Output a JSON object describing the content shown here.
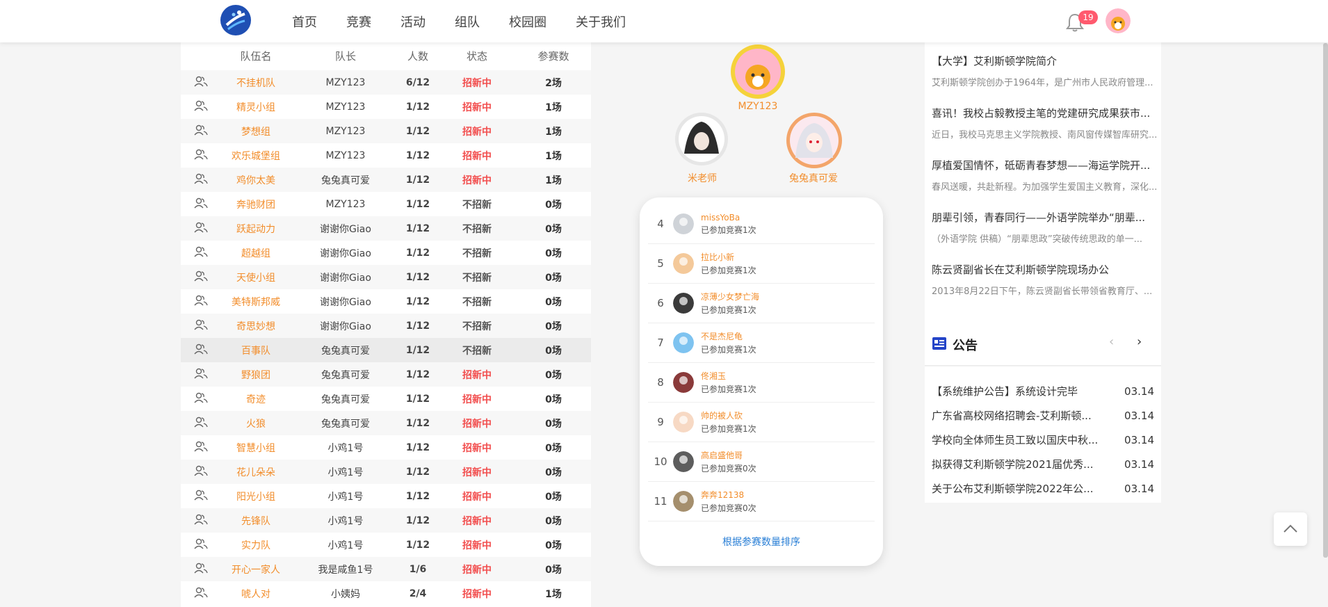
{
  "header": {
    "nav": [
      "首页",
      "竞赛",
      "活动",
      "组队",
      "校园圈",
      "关于我们"
    ],
    "notification_count": "19"
  },
  "team_table": {
    "columns": [
      "队伍名",
      "队长",
      "人数",
      "状态",
      "参赛数"
    ],
    "rows": [
      {
        "name": "不挂机队",
        "leader": "MZY123",
        "count": "6/12",
        "status": "招新中",
        "games": "2场"
      },
      {
        "name": "精灵小组",
        "leader": "MZY123",
        "count": "1/12",
        "status": "招新中",
        "games": "1场"
      },
      {
        "name": "梦想组",
        "leader": "MZY123",
        "count": "1/12",
        "status": "招新中",
        "games": "1场"
      },
      {
        "name": "欢乐城堡组",
        "leader": "MZY123",
        "count": "1/12",
        "status": "招新中",
        "games": "1场"
      },
      {
        "name": "鸡你太美",
        "leader": "兔兔真可爱",
        "count": "1/12",
        "status": "招新中",
        "games": "1场"
      },
      {
        "name": "奔驰财团",
        "leader": "MZY123",
        "count": "1/12",
        "status": "不招新",
        "games": "0场"
      },
      {
        "name": "跃起动力",
        "leader": "谢谢你Giao",
        "count": "1/12",
        "status": "不招新",
        "games": "0场"
      },
      {
        "name": "超越组",
        "leader": "谢谢你Giao",
        "count": "1/12",
        "status": "不招新",
        "games": "0场"
      },
      {
        "name": "天使小组",
        "leader": "谢谢你Giao",
        "count": "1/12",
        "status": "不招新",
        "games": "0场"
      },
      {
        "name": "美特斯邦威",
        "leader": "谢谢你Giao",
        "count": "1/12",
        "status": "不招新",
        "games": "0场"
      },
      {
        "name": "奇思妙想",
        "leader": "谢谢你Giao",
        "count": "1/12",
        "status": "不招新",
        "games": "0场"
      },
      {
        "name": "百事队",
        "leader": "兔兔真可爱",
        "count": "1/12",
        "status": "不招新",
        "games": "0场"
      },
      {
        "name": "野狼团",
        "leader": "兔兔真可爱",
        "count": "1/12",
        "status": "招新中",
        "games": "0场"
      },
      {
        "name": "奇迹",
        "leader": "兔兔真可爱",
        "count": "1/12",
        "status": "招新中",
        "games": "0场"
      },
      {
        "name": "火狼",
        "leader": "兔兔真可爱",
        "count": "1/12",
        "status": "招新中",
        "games": "0场"
      },
      {
        "name": "智慧小组",
        "leader": "小鸡1号",
        "count": "1/12",
        "status": "招新中",
        "games": "0场"
      },
      {
        "name": "花儿朵朵",
        "leader": "小鸡1号",
        "count": "1/12",
        "status": "招新中",
        "games": "0场"
      },
      {
        "name": "阳光小组",
        "leader": "小鸡1号",
        "count": "1/12",
        "status": "招新中",
        "games": "0场"
      },
      {
        "name": "先锋队",
        "leader": "小鸡1号",
        "count": "1/12",
        "status": "招新中",
        "games": "0场"
      },
      {
        "name": "实力队",
        "leader": "小鸡1号",
        "count": "1/12",
        "status": "招新中",
        "games": "0场"
      },
      {
        "name": "开心一家人",
        "leader": "我是咸鱼1号",
        "count": "1/6",
        "status": "招新中",
        "games": "0场"
      },
      {
        "name": "唬人对",
        "leader": "小姨妈",
        "count": "2/4",
        "status": "招新中",
        "games": "1场"
      }
    ]
  },
  "podium": {
    "first": "MZY123",
    "second": "米老师",
    "third": "兔兔真可爱"
  },
  "ranking": {
    "items": [
      {
        "rank": "4",
        "name": "missYoBa",
        "sub": "已参加竞赛1次"
      },
      {
        "rank": "5",
        "name": "拉比小新",
        "sub": "已参加竞赛1次"
      },
      {
        "rank": "6",
        "name": "凉薄少女梦亡海",
        "sub": "已参加竞赛1次"
      },
      {
        "rank": "7",
        "name": "不是杰尼龟",
        "sub": "已参加竞赛1次"
      },
      {
        "rank": "8",
        "name": "佟湘玉",
        "sub": "已参加竞赛1次"
      },
      {
        "rank": "9",
        "name": "帅的被人砍",
        "sub": "已参加竞赛1次"
      },
      {
        "rank": "10",
        "name": "高启盛他哥",
        "sub": "已参加竞赛0次"
      },
      {
        "rank": "11",
        "name": "奔奔12138",
        "sub": "已参加竞赛0次"
      }
    ],
    "sort_label": "根据参赛数量排序"
  },
  "news": [
    {
      "title": "【大学】艾利斯顿学院简介",
      "desc": "艾利斯顿学院创办于1964年，是广州市人民政府管理..."
    },
    {
      "title": "喜讯！我校占毅教授主笔的党建研究成果获市...",
      "desc": "近日，我校马克思主义学院教授、南风窗传媒智库研究..."
    },
    {
      "title": "厚植爱国情怀，砥砺青春梦想——海运学院开...",
      "desc": "春风送暖，共赴新程。为加强学生爱国主义教育，深化..."
    },
    {
      "title": "朋辈引领，青春同行——外语学院举办“朋辈...",
      "desc": "（外语学院 供稿）“朋辈思政”突破传统思政的单一..."
    },
    {
      "title": "陈云贤副省长在艾利斯顿学院现场办公",
      "desc": "2013年8月22日下午，陈云贤副省长带领省教育厅、..."
    }
  ],
  "notice": {
    "title": "公告",
    "items": [
      {
        "text": "【系统维护公告】系统设计完毕",
        "date": "03.14"
      },
      {
        "text": "广东省高校网络招聘会-艾利斯顿...",
        "date": "03.14"
      },
      {
        "text": "学校向全体师生员工致以国庆中秋...",
        "date": "03.14"
      },
      {
        "text": "拟获得艾利斯顿学院2021届优秀...",
        "date": "03.14"
      },
      {
        "text": "关于公布艾利斯顿学院2022年公...",
        "date": "03.14"
      }
    ]
  },
  "colors": {
    "accent_orange": "#f28d2b",
    "status_red": "#f24e4e",
    "link_blue": "#2a7fd6",
    "badge_red": "#ff5a6e"
  },
  "icons": [
    "logo-icon",
    "bell-icon",
    "team-icon",
    "notice-icon",
    "chevron-left-icon",
    "chevron-right-icon",
    "back-to-top-icon"
  ]
}
